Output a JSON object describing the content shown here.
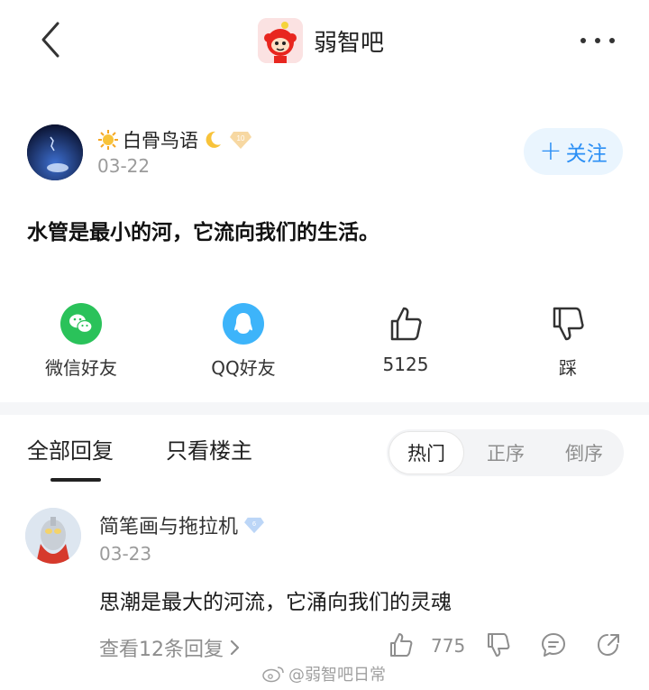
{
  "header": {
    "forum_name": "弱智吧",
    "back_icon": "chevron-left-icon",
    "more_icon": "more-dots-icon"
  },
  "post": {
    "author_name": "白骨鸟语",
    "author_level": "10",
    "date": "03-22",
    "follow_label": "关注",
    "content": "水管是最小的河，它流向我们的生活。"
  },
  "share": {
    "wechat_label": "微信好友",
    "qq_label": "QQ好友",
    "like_count": "5125",
    "dislike_label": "踩"
  },
  "tabs": {
    "all_replies": "全部回复",
    "op_only": "只看楼主",
    "sort_hot": "热门",
    "sort_asc": "正序",
    "sort_desc": "倒序"
  },
  "reply": {
    "author_name": "简笔画与拖拉机",
    "author_level": "6",
    "date": "03-23",
    "content": "思潮是最大的河流，它涌向我们的灵魂",
    "view_replies": "查看12条回复",
    "like_count": "775"
  },
  "watermark": {
    "text": "@弱智吧日常"
  },
  "colors": {
    "accent_blue": "#2b8ff5",
    "wechat_green": "#2ac25a",
    "qq_blue": "#3db4fa",
    "divider": "#f5f6f8"
  }
}
